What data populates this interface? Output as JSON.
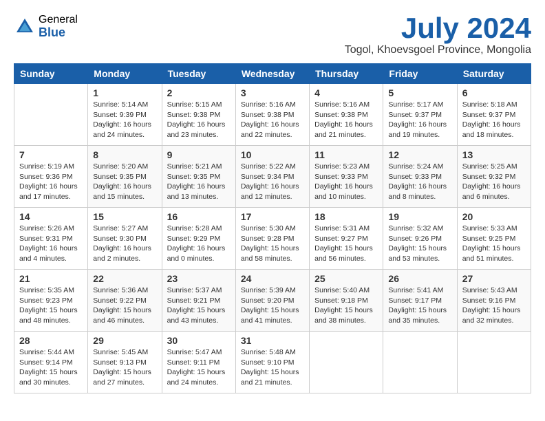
{
  "header": {
    "logo_general": "General",
    "logo_blue": "Blue",
    "month": "July 2024",
    "location": "Togol, Khoevsgoel Province, Mongolia"
  },
  "calendar": {
    "days_of_week": [
      "Sunday",
      "Monday",
      "Tuesday",
      "Wednesday",
      "Thursday",
      "Friday",
      "Saturday"
    ],
    "weeks": [
      [
        {
          "day": "",
          "content": ""
        },
        {
          "day": "1",
          "content": "Sunrise: 5:14 AM\nSunset: 9:39 PM\nDaylight: 16 hours\nand 24 minutes."
        },
        {
          "day": "2",
          "content": "Sunrise: 5:15 AM\nSunset: 9:38 PM\nDaylight: 16 hours\nand 23 minutes."
        },
        {
          "day": "3",
          "content": "Sunrise: 5:16 AM\nSunset: 9:38 PM\nDaylight: 16 hours\nand 22 minutes."
        },
        {
          "day": "4",
          "content": "Sunrise: 5:16 AM\nSunset: 9:38 PM\nDaylight: 16 hours\nand 21 minutes."
        },
        {
          "day": "5",
          "content": "Sunrise: 5:17 AM\nSunset: 9:37 PM\nDaylight: 16 hours\nand 19 minutes."
        },
        {
          "day": "6",
          "content": "Sunrise: 5:18 AM\nSunset: 9:37 PM\nDaylight: 16 hours\nand 18 minutes."
        }
      ],
      [
        {
          "day": "7",
          "content": "Sunrise: 5:19 AM\nSunset: 9:36 PM\nDaylight: 16 hours\nand 17 minutes."
        },
        {
          "day": "8",
          "content": "Sunrise: 5:20 AM\nSunset: 9:35 PM\nDaylight: 16 hours\nand 15 minutes."
        },
        {
          "day": "9",
          "content": "Sunrise: 5:21 AM\nSunset: 9:35 PM\nDaylight: 16 hours\nand 13 minutes."
        },
        {
          "day": "10",
          "content": "Sunrise: 5:22 AM\nSunset: 9:34 PM\nDaylight: 16 hours\nand 12 minutes."
        },
        {
          "day": "11",
          "content": "Sunrise: 5:23 AM\nSunset: 9:33 PM\nDaylight: 16 hours\nand 10 minutes."
        },
        {
          "day": "12",
          "content": "Sunrise: 5:24 AM\nSunset: 9:33 PM\nDaylight: 16 hours\nand 8 minutes."
        },
        {
          "day": "13",
          "content": "Sunrise: 5:25 AM\nSunset: 9:32 PM\nDaylight: 16 hours\nand 6 minutes."
        }
      ],
      [
        {
          "day": "14",
          "content": "Sunrise: 5:26 AM\nSunset: 9:31 PM\nDaylight: 16 hours\nand 4 minutes."
        },
        {
          "day": "15",
          "content": "Sunrise: 5:27 AM\nSunset: 9:30 PM\nDaylight: 16 hours\nand 2 minutes."
        },
        {
          "day": "16",
          "content": "Sunrise: 5:28 AM\nSunset: 9:29 PM\nDaylight: 16 hours\nand 0 minutes."
        },
        {
          "day": "17",
          "content": "Sunrise: 5:30 AM\nSunset: 9:28 PM\nDaylight: 15 hours\nand 58 minutes."
        },
        {
          "day": "18",
          "content": "Sunrise: 5:31 AM\nSunset: 9:27 PM\nDaylight: 15 hours\nand 56 minutes."
        },
        {
          "day": "19",
          "content": "Sunrise: 5:32 AM\nSunset: 9:26 PM\nDaylight: 15 hours\nand 53 minutes."
        },
        {
          "day": "20",
          "content": "Sunrise: 5:33 AM\nSunset: 9:25 PM\nDaylight: 15 hours\nand 51 minutes."
        }
      ],
      [
        {
          "day": "21",
          "content": "Sunrise: 5:35 AM\nSunset: 9:23 PM\nDaylight: 15 hours\nand 48 minutes."
        },
        {
          "day": "22",
          "content": "Sunrise: 5:36 AM\nSunset: 9:22 PM\nDaylight: 15 hours\nand 46 minutes."
        },
        {
          "day": "23",
          "content": "Sunrise: 5:37 AM\nSunset: 9:21 PM\nDaylight: 15 hours\nand 43 minutes."
        },
        {
          "day": "24",
          "content": "Sunrise: 5:39 AM\nSunset: 9:20 PM\nDaylight: 15 hours\nand 41 minutes."
        },
        {
          "day": "25",
          "content": "Sunrise: 5:40 AM\nSunset: 9:18 PM\nDaylight: 15 hours\nand 38 minutes."
        },
        {
          "day": "26",
          "content": "Sunrise: 5:41 AM\nSunset: 9:17 PM\nDaylight: 15 hours\nand 35 minutes."
        },
        {
          "day": "27",
          "content": "Sunrise: 5:43 AM\nSunset: 9:16 PM\nDaylight: 15 hours\nand 32 minutes."
        }
      ],
      [
        {
          "day": "28",
          "content": "Sunrise: 5:44 AM\nSunset: 9:14 PM\nDaylight: 15 hours\nand 30 minutes."
        },
        {
          "day": "29",
          "content": "Sunrise: 5:45 AM\nSunset: 9:13 PM\nDaylight: 15 hours\nand 27 minutes."
        },
        {
          "day": "30",
          "content": "Sunrise: 5:47 AM\nSunset: 9:11 PM\nDaylight: 15 hours\nand 24 minutes."
        },
        {
          "day": "31",
          "content": "Sunrise: 5:48 AM\nSunset: 9:10 PM\nDaylight: 15 hours\nand 21 minutes."
        },
        {
          "day": "",
          "content": ""
        },
        {
          "day": "",
          "content": ""
        },
        {
          "day": "",
          "content": ""
        }
      ]
    ]
  }
}
